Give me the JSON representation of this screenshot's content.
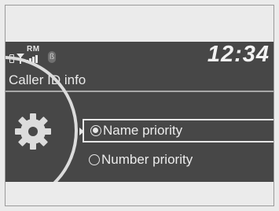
{
  "status": {
    "roaming_label": "RM",
    "clock": "12:34",
    "bluetooth_icon": "bluetooth-icon",
    "signal_bars": 4
  },
  "screen": {
    "title": "Caller ID info",
    "settings_icon": "gear-icon"
  },
  "options": [
    {
      "label": "Name priority",
      "selected": true
    },
    {
      "label": "Number priority",
      "selected": false
    }
  ],
  "colors": {
    "screen_bg": "#474747",
    "text": "#ececec",
    "page_bg": "#ebebeb"
  }
}
